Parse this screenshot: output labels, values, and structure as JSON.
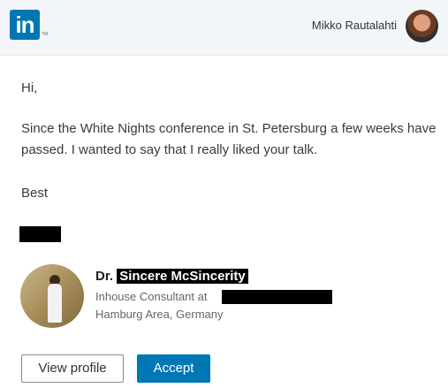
{
  "header": {
    "logo_text": "in",
    "logo_tm": "TM",
    "user_name": "Mikko Rautalahti",
    "avatar_icon": "user-avatar"
  },
  "message": {
    "greeting": "Hi,",
    "body": "Since the White Nights conference in St. Petersburg a few weeks have passed. I wanted to say that I really liked your talk.",
    "signoff": "Best"
  },
  "profile": {
    "name_prefix": "Dr.",
    "name": "Sincere McSincerity",
    "title": "Inhouse Consultant at",
    "location": "Hamburg Area, Germany"
  },
  "actions": {
    "view_profile": "View profile",
    "accept": "Accept"
  },
  "colors": {
    "brand": "#0077b5",
    "header_bg": "#f3f6f8",
    "redaction": "#000000"
  }
}
